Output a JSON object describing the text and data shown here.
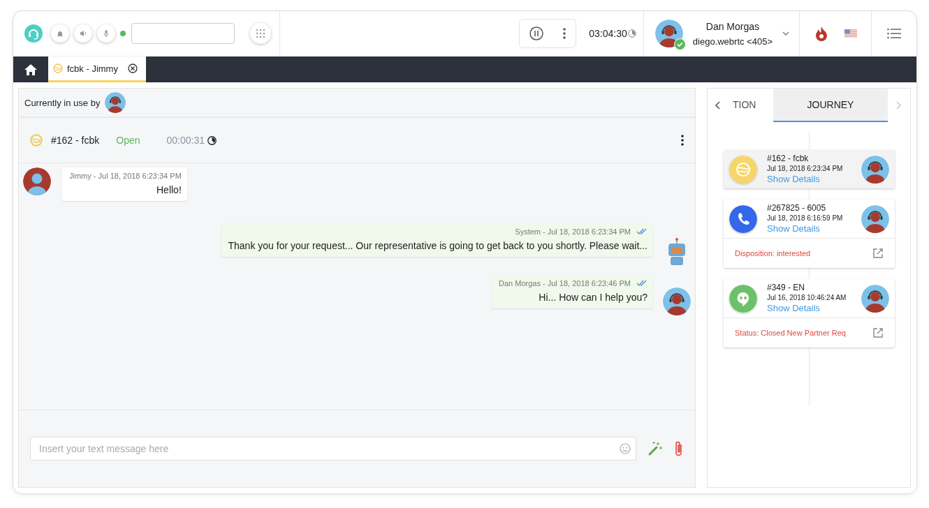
{
  "toolbar": {
    "connected": true,
    "timer": "03:04:30",
    "agent": {
      "name": "Dan Morgas",
      "extension": "diego.webrtc <405>",
      "available": true
    }
  },
  "tabs": [
    {
      "kind": "home",
      "selected": false
    },
    {
      "kind": "chat",
      "label": "fcbk - Jimmy",
      "selected": true
    }
  ],
  "conversation": {
    "in_use_label": "Currently in use by",
    "title": "#162 - fcbk",
    "status": "Open",
    "duration": "00:00:31",
    "messages": [
      {
        "kind": "customer",
        "meta": "Jimmy - Jul 18, 2018 6:23:34 PM",
        "text": "Hello!",
        "read": false
      },
      {
        "kind": "bot",
        "meta": "System - Jul 18, 2018 6:23:34 PM",
        "text": "Thank you for your request... Our representative is going to get back to you shortly. Please wait...",
        "read": true
      },
      {
        "kind": "agent",
        "meta": "Dan Morgas - Jul 18, 2018 6:23:46 PM",
        "text": "Hi... How can I help you?",
        "read": true
      }
    ],
    "composer": {
      "placeholder": "Insert your text message here"
    }
  },
  "side_panel": {
    "tabs": [
      {
        "label": "TION",
        "selected": false
      },
      {
        "label": "JOURNEY",
        "selected": true
      }
    ],
    "journey": [
      {
        "kind": "chat",
        "color": "#f6d66b",
        "title": "#162 - fcbk",
        "time": "Jul 18, 2018 6:23:34 PM",
        "link": "Show Details",
        "highlighted": true
      },
      {
        "kind": "call",
        "color": "#3568e8",
        "title": "#267825 - 6005",
        "time": "Jul 18, 2018 6:16:59 PM",
        "link": "Show Details",
        "highlighted": false,
        "note": "Disposition: interested"
      },
      {
        "kind": "hangouts",
        "color": "#6cc06a",
        "title": "#349 - EN",
        "time": "Jul 16, 2018 10:46:24 AM",
        "link": "Show Details",
        "highlighted": false,
        "note": "Status: Closed New Partner Req"
      }
    ]
  }
}
